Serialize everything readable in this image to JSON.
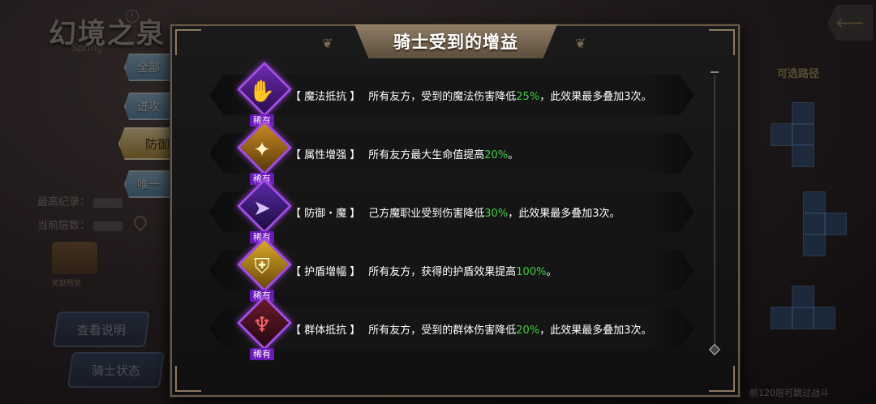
{
  "background": {
    "title": "幻境之泉",
    "subtitle": "Spring",
    "info_icon": "info-icon",
    "stats": [
      {
        "label": "最高纪录："
      },
      {
        "label": "当前层数："
      }
    ],
    "chest_label": "奖励预览",
    "buttons": {
      "view_rules": "查看说明",
      "knight_status": "骑士状态"
    },
    "tabs": [
      "全部",
      "进攻",
      "防御",
      "唯一"
    ],
    "active_tab": "防御",
    "right_title": "可选路径",
    "bottom_hint": "前120层可跳过战斗",
    "back_icon": "back-arrow-icon"
  },
  "modal": {
    "title": "骑士受到的增益",
    "buffs": [
      {
        "icon": "ghost-hand-icon",
        "rarity": "稀有",
        "name": "【 魔法抵抗 】",
        "pre": "所有友方，受到的魔法伤害降低",
        "value": "25%",
        "post": "，此效果最多叠加3次。",
        "glyph": "✋",
        "color": "#9b57e8"
      },
      {
        "icon": "star-burst-icon",
        "rarity": "稀有",
        "name": "【 属性增强 】",
        "pre": "所有友方最大生命值提高",
        "value": "20%",
        "post": "。",
        "glyph": "✦",
        "color": "#e7b43b"
      },
      {
        "icon": "magic-arrow-icon",
        "rarity": "稀有",
        "name": "【 防御・魔 】",
        "pre": "己方魔职业受到伤害降低",
        "value": "30%",
        "post": "，此效果最多叠加3次。",
        "glyph": "➤",
        "color": "#9b57e8"
      },
      {
        "icon": "shield-icon",
        "rarity": "稀有",
        "name": "【 护盾增幅 】",
        "pre": "所有友方，获得的护盾效果提高",
        "value": "100%",
        "post": "。",
        "glyph": "⛨",
        "color": "#f0c53a"
      },
      {
        "icon": "triple-blade-icon",
        "rarity": "稀有",
        "name": "【 群体抵抗 】",
        "pre": "所有友方，受到的群体伤害降低",
        "value": "20%",
        "post": "，此效果最多叠加3次。",
        "glyph": "♆",
        "color": "#d0404a"
      }
    ]
  }
}
